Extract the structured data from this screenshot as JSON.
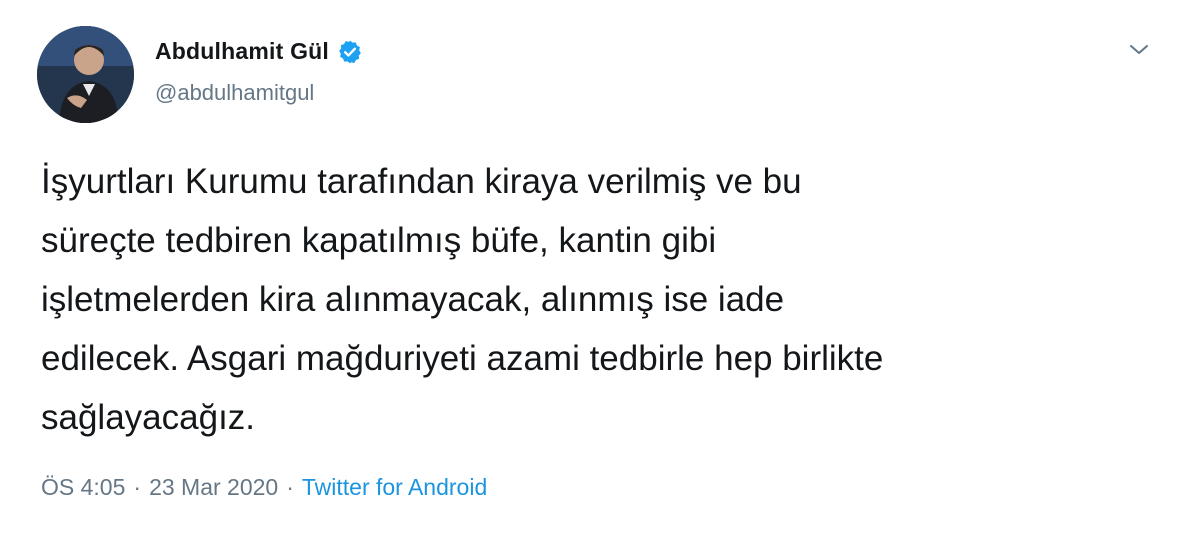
{
  "user": {
    "display_name": "Abdulhamit Gül",
    "handle": "@abdulhamitgul",
    "verified": true,
    "verified_icon": "verified-badge-icon",
    "verified_color": "#1da1f2"
  },
  "menu_icon": "chevron-down-icon",
  "tweet": {
    "text": "İşyurtları Kurumu tarafından kiraya verilmiş ve bu\nsüreçte tedbiren kapatılmış büfe, kantin gibi\nişletmelerden kira alınmayacak, alınmış ise iade\nedilecek. Asgari mağduriyeti azami tedbirle hep birlikte\nsağlayacağız."
  },
  "meta": {
    "time": "ÖS 4:05",
    "separator1": "·",
    "date": "23 Mar 2020",
    "separator2": "·",
    "source": "Twitter for Android"
  },
  "colors": {
    "text": "#14171a",
    "secondary": "#657786",
    "link": "#1b95e0"
  }
}
